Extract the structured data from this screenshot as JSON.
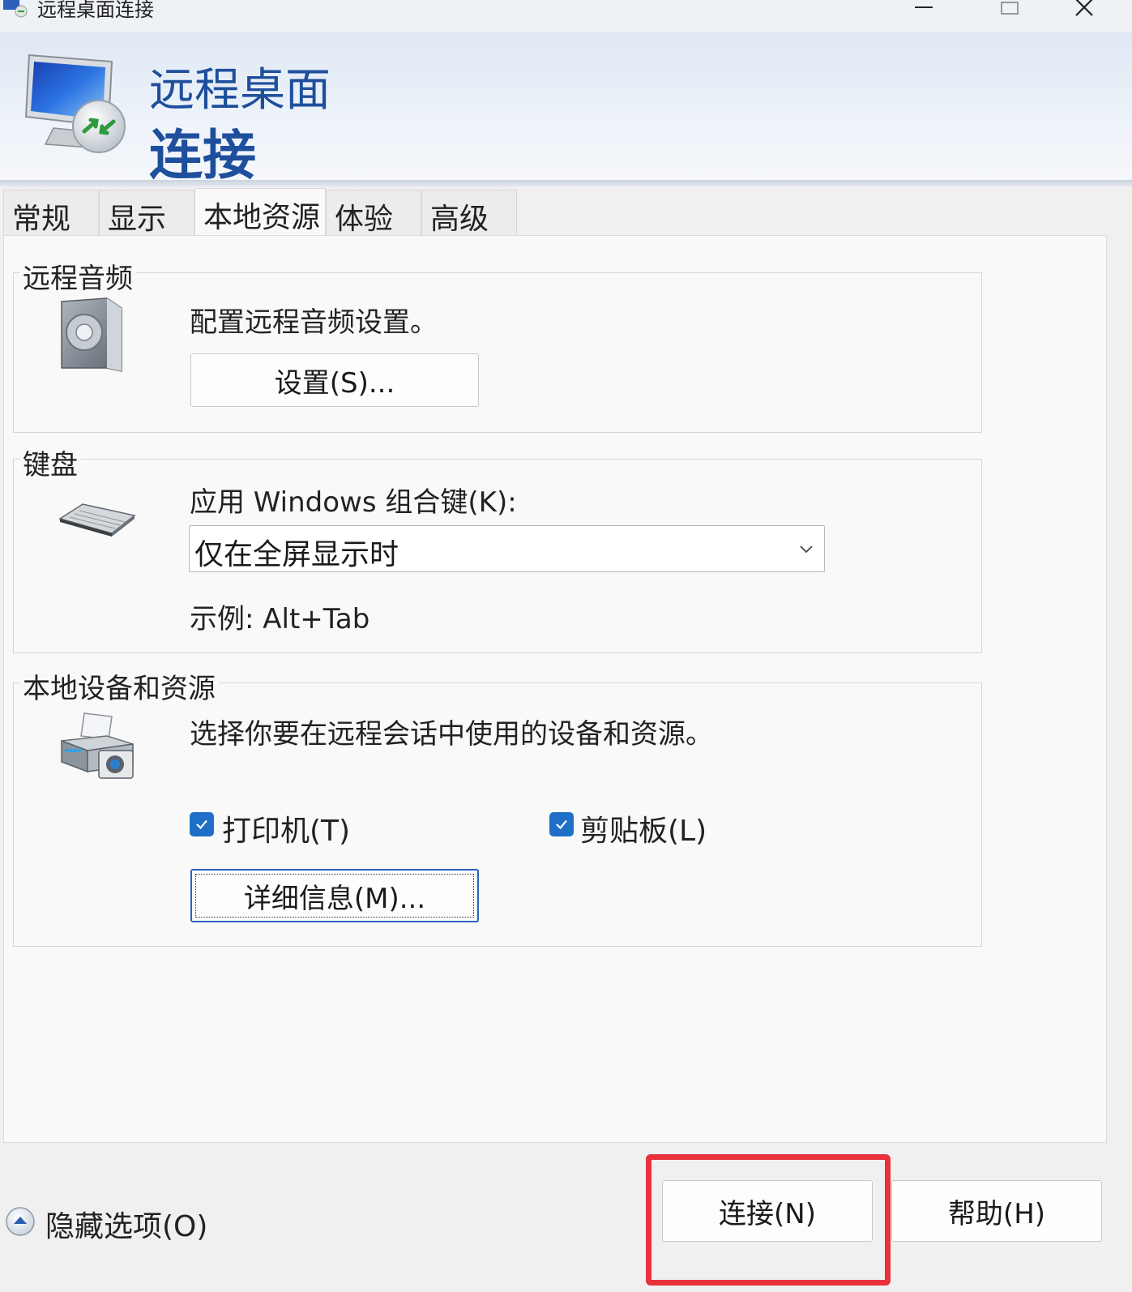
{
  "window": {
    "title": "远程桌面连接",
    "icon": "remote-desktop-icon"
  },
  "banner": {
    "line1": "远程桌面",
    "line2": "连接",
    "icon": "monitor-connect-icon"
  },
  "tabs": [
    {
      "label": "常规",
      "active": false
    },
    {
      "label": "显示",
      "active": false
    },
    {
      "label": "本地资源",
      "active": true
    },
    {
      "label": "体验",
      "active": false
    },
    {
      "label": "高级",
      "active": false
    }
  ],
  "remote_audio": {
    "title": "远程音频",
    "description": "配置远程音频设置。",
    "settings_button": "设置(S)...",
    "icon": "speaker-icon"
  },
  "keyboard": {
    "title": "键盘",
    "label": "应用 Windows 组合键(K):",
    "selected_option": "仅在全屏显示时",
    "example": "示例: Alt+Tab",
    "icon": "keyboard-icon"
  },
  "local_devices": {
    "title": "本地设备和资源",
    "description": "选择你要在远程会话中使用的设备和资源。",
    "printer_label": "打印机(T)",
    "printer_checked": true,
    "clipboard_label": "剪贴板(L)",
    "clipboard_checked": true,
    "more_button": "详细信息(M)...",
    "icon": "printer-camera-icon"
  },
  "footer": {
    "hide_options": "隐藏选项(O)",
    "connect_button": "连接(N)",
    "help_button": "帮助(H)"
  },
  "colors": {
    "accent": "#1f6fc9",
    "banner_text": "#1e4f9c",
    "highlight": "#e8313a"
  }
}
